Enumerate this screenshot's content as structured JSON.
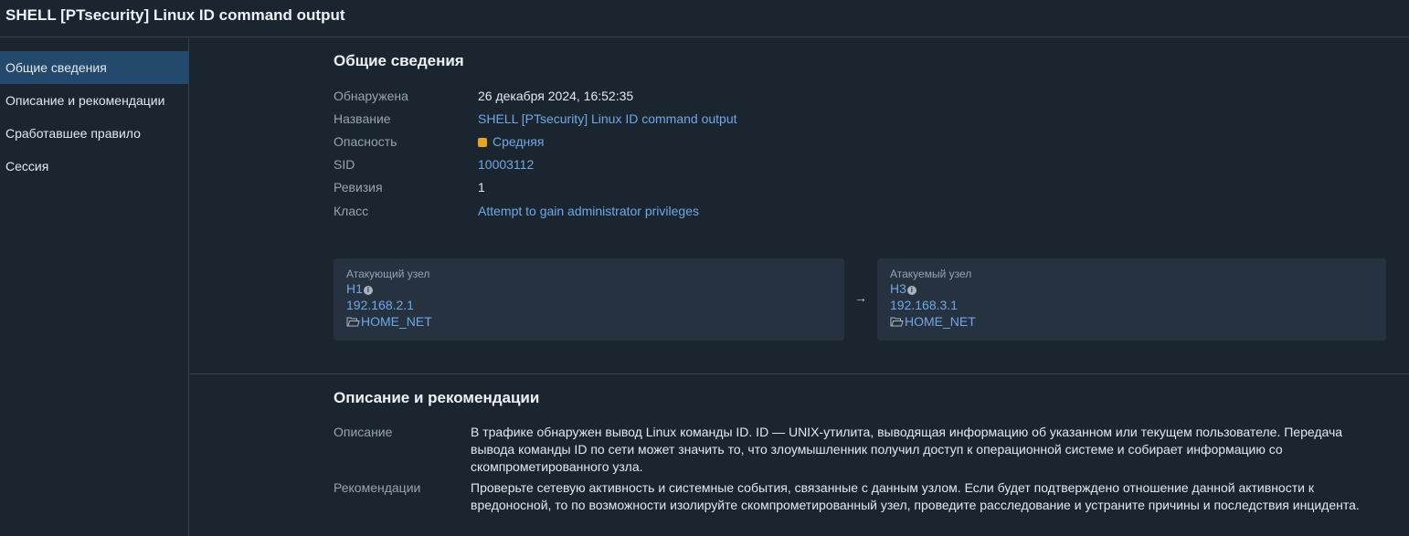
{
  "window": {
    "title": "SHELL [PTsecurity] Linux ID command output"
  },
  "sidebar": {
    "items": [
      {
        "label": "Общие сведения",
        "active": true
      },
      {
        "label": "Описание и рекомендации",
        "active": false
      },
      {
        "label": "Сработавшее правило",
        "active": false
      },
      {
        "label": "Сессия",
        "active": false
      }
    ]
  },
  "general": {
    "title": "Общие сведения",
    "fields": {
      "detected": {
        "label": "Обнаружена",
        "value": "26 декабря 2024, 16:52:35"
      },
      "name": {
        "label": "Название",
        "value": "SHELL [PTsecurity] Linux ID command output"
      },
      "severity": {
        "label": "Опасность",
        "value": "Средняя",
        "color": "#e8a320"
      },
      "sid": {
        "label": "SID",
        "value": "10003112"
      },
      "revision": {
        "label": "Ревизия",
        "value": "1"
      },
      "class": {
        "label": "Класс",
        "value": "Attempt to gain administrator privileges"
      }
    },
    "attacker": {
      "label": "Атакующий узел",
      "host": "H1",
      "ip": "192.168.2.1",
      "network": "HOME_NET"
    },
    "arrow": "→",
    "target": {
      "label": "Атакуемый узел",
      "host": "H3",
      "ip": "192.168.3.1",
      "network": "HOME_NET"
    }
  },
  "description": {
    "title": "Описание и рекомендации",
    "desc_label": "Описание",
    "desc_lines": [
      "В трафике обнаружен вывод Linux команды ID. ID — UNIX-утилита, выводящая информацию об указанном или текущем пользователе. Передача",
      "вывода команды ID по сети может значить то, что злоумышленник получил доступ к операционной системе и собирает информацию со",
      "скомпрометированного узла."
    ],
    "rec_label": "Рекомендации",
    "rec_lines": [
      "Проверьте сетевую активность и системные события, связанные с данным узлом. Если будет подтверждено отношение данной активности к",
      "вредоносной, то по возможности изолируйте скомпрометированный узел, проведите расследование и устраните причины и последствия инцидента."
    ]
  },
  "colors": {
    "background": "#1b2530",
    "sidebar_active": "#234a6d",
    "link": "#6fa8e6",
    "card": "#263240"
  },
  "icons": [
    "info-icon",
    "folder-icon",
    "arrow-right-icon"
  ]
}
